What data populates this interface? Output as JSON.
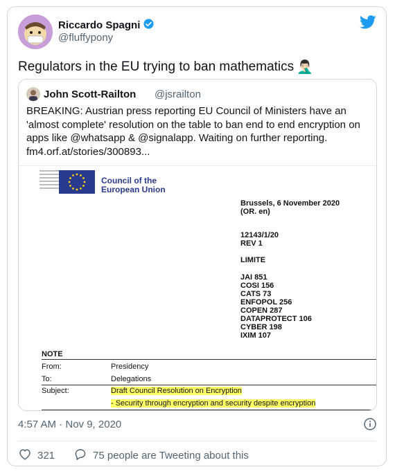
{
  "author": {
    "name": "Riccardo Spagni",
    "handle": "@fluffypony"
  },
  "tweet": {
    "text": "Regulators in the EU trying to ban mathematics",
    "emoji": "🤦🏻‍♂️"
  },
  "quote": {
    "name": "John Scott-Railton",
    "handle": "@jsrailton",
    "text": "BREAKING: Austrian press reporting EU Council of Ministers have an 'almost complete' resolution on the table to ban end to end encryption on apps like @whatsapp & @signalapp.  Waiting on further reporting. fm4.orf.at/stories/300893..."
  },
  "document": {
    "org_line1": "Council of the",
    "org_line2": "European Union",
    "date_line": "Brussels, 6 November 2020",
    "lang_line": "(OR. en)",
    "ref": "12143/1/20",
    "rev": "REV 1",
    "limite": "LIMITE",
    "codes": [
      "JAI 851",
      "COSI 156",
      "CATS 73",
      "ENFOPOL 256",
      "COPEN 287",
      "DATAPROTECT 106",
      "CYBER 198",
      "IXIM 107"
    ],
    "note_label": "NOTE",
    "from_label": "From:",
    "from_value": "Presidency",
    "to_label": "To:",
    "to_value": "Delegations",
    "subject_label": "Subject:",
    "subject_line1": "Draft Council Resolution on Encryption",
    "subject_line2": "- Security through encryption and security despite encryption"
  },
  "meta": {
    "timestamp": "4:57 AM · Nov 9, 2020",
    "likes": "321",
    "retweets_text": "75 people are Tweeting about this"
  },
  "colors": {
    "twitter_blue": "#1d9bf0",
    "eu_blue": "#2a3b8f",
    "highlight": "#ffff66"
  }
}
